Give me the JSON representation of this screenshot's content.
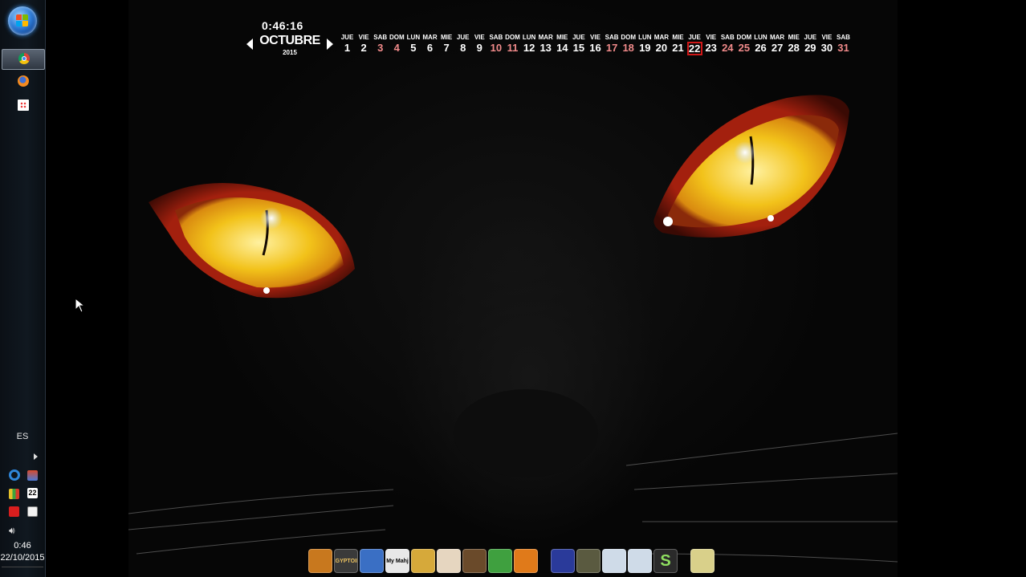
{
  "taskbar": {
    "language": "ES",
    "clock_time": "0:46",
    "clock_date": "22/10/2015",
    "pinned": [
      {
        "name": "chrome-icon",
        "active": true
      },
      {
        "name": "firefox-icon",
        "active": false
      },
      {
        "name": "apps-grid-icon",
        "active": false
      }
    ],
    "tray_icons": [
      "network-ring-icon",
      "monitor-icon",
      "charts-icon",
      "calendar-22-icon",
      "runner-icon",
      "clipboard-icon"
    ],
    "tray_calendar_day": "22"
  },
  "calendar_widget": {
    "time": "0:46:16",
    "month": "OCTUBRE",
    "year": "2015",
    "today": 22,
    "days": [
      {
        "dn": "JUE",
        "d": "1"
      },
      {
        "dn": "VIE",
        "d": "2"
      },
      {
        "dn": "SAB",
        "d": "3",
        "weekend": true
      },
      {
        "dn": "DOM",
        "d": "4",
        "weekend": true
      },
      {
        "dn": "LUN",
        "d": "5"
      },
      {
        "dn": "MAR",
        "d": "6"
      },
      {
        "dn": "MIE",
        "d": "7"
      },
      {
        "dn": "JUE",
        "d": "8"
      },
      {
        "dn": "VIE",
        "d": "9"
      },
      {
        "dn": "SAB",
        "d": "10",
        "weekend": true
      },
      {
        "dn": "DOM",
        "d": "11",
        "weekend": true
      },
      {
        "dn": "LUN",
        "d": "12"
      },
      {
        "dn": "MAR",
        "d": "13"
      },
      {
        "dn": "MIE",
        "d": "14"
      },
      {
        "dn": "JUE",
        "d": "15"
      },
      {
        "dn": "VIE",
        "d": "16"
      },
      {
        "dn": "SAB",
        "d": "17",
        "weekend": true
      },
      {
        "dn": "DOM",
        "d": "18",
        "weekend": true
      },
      {
        "dn": "LUN",
        "d": "19"
      },
      {
        "dn": "MAR",
        "d": "20"
      },
      {
        "dn": "MIE",
        "d": "21"
      },
      {
        "dn": "JUE",
        "d": "22",
        "today": true
      },
      {
        "dn": "VIE",
        "d": "23"
      },
      {
        "dn": "SAB",
        "d": "24",
        "weekend": true
      },
      {
        "dn": "DOM",
        "d": "25",
        "weekend": true
      },
      {
        "dn": "LUN",
        "d": "26"
      },
      {
        "dn": "MAR",
        "d": "27"
      },
      {
        "dn": "MIE",
        "d": "28"
      },
      {
        "dn": "JUE",
        "d": "29"
      },
      {
        "dn": "VIE",
        "d": "30"
      },
      {
        "dn": "SAB",
        "d": "31",
        "weekend": true
      }
    ]
  },
  "dock": {
    "items": [
      {
        "name": "pharaoh-mask-icon",
        "color": "#c8781e"
      },
      {
        "name": "egyptoid-icon",
        "color": "#3a3a3a",
        "label": "EGYPTOID"
      },
      {
        "name": "cartoon-face-icon",
        "color": "#3a6fc4"
      },
      {
        "name": "my-mahjong-icon",
        "color": "#e8e8e8",
        "label": "My Mahj"
      },
      {
        "name": "crown-icon",
        "color": "#d6a93a"
      },
      {
        "name": "mahjong-tile-icon",
        "color": "#e6d6c0"
      },
      {
        "name": "card-game-icon",
        "color": "#6a4a2a"
      },
      {
        "name": "zombie-face-icon",
        "color": "#3fa03f"
      },
      {
        "name": "lantern-icon",
        "color": "#e07a1a"
      },
      {
        "name": "blue-banner-icon",
        "color": "#2a3a9a"
      },
      {
        "name": "stone-disc-icon",
        "color": "#5a5a40"
      },
      {
        "name": "settings-gear-icon",
        "color": "#cfdbe8"
      },
      {
        "name": "settings-gear-2-icon",
        "color": "#cfdbe8"
      },
      {
        "name": "s-logo-icon",
        "color": "#2a2a2a",
        "label": "S"
      },
      {
        "name": "folder-icon",
        "color": "#d9d08a"
      }
    ]
  },
  "colors": {
    "weekend": "#f08a8a",
    "today_border": "#d01818",
    "eye": "#f2c21a",
    "eye_rim": "#a3200e"
  }
}
